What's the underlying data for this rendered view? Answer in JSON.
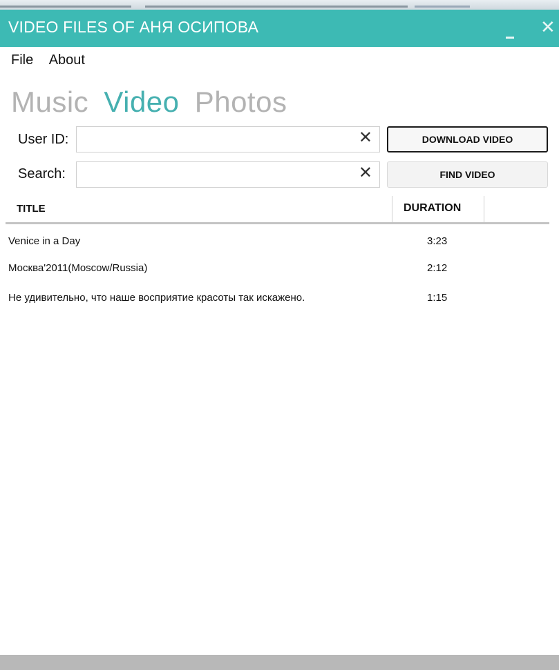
{
  "window": {
    "title": "VIDEO FILES OF АНЯ ОСИПОВА",
    "minimize_symbol": "",
    "close_symbol": "✕",
    "accent_color": "#3dbab4"
  },
  "menu": {
    "items": [
      "File",
      "About"
    ]
  },
  "tabs": {
    "music": "Music",
    "video": "Video",
    "photos": "Photos",
    "active": "video"
  },
  "form": {
    "user_id_label": "User ID:",
    "user_id_value": "",
    "search_label": "Search:",
    "search_value": "",
    "clear_symbol": "✕",
    "download_button": "DOWNLOAD VIDEO",
    "find_button": "FIND VIDEO"
  },
  "table": {
    "columns": [
      "TITLE",
      "DURATION"
    ],
    "rows": [
      {
        "title": "Venice in a Day",
        "duration": "3:23"
      },
      {
        "title": "Москва'2011(Moscow/Russia)",
        "duration": "2:12"
      },
      {
        "title": "Не удивительно, что наше восприятие красоты так искажено.",
        "duration": "1:15"
      }
    ]
  }
}
